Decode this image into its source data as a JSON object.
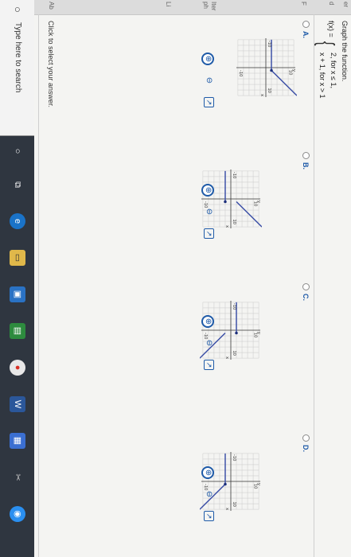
{
  "question": {
    "prompt": "Graph the function.",
    "lhs": "f(x) =",
    "case1": "2,  for x ≤ 1,",
    "case2": "x + 1,  for x > 1"
  },
  "left_strip": [
    "er",
    "d",
    "F",
    "Iter",
    "ph",
    "Li",
    "Ab"
  ],
  "options": [
    {
      "label": "A.",
      "tick_top": "10",
      "tick_left": "-10",
      "tick_right": "10",
      "tick_bottom": "-10",
      "axis_y": "y",
      "axis_x": "x"
    },
    {
      "label": "B.",
      "tick_top": "10",
      "tick_left": "-10",
      "tick_right": "10",
      "tick_bottom": "-10",
      "axis_y": "y",
      "axis_x": "x"
    },
    {
      "label": "C.",
      "tick_top": "10",
      "tick_left": "-10",
      "tick_right": "10",
      "tick_bottom": "-10",
      "axis_y": "y",
      "axis_x": "x"
    },
    {
      "label": "D.",
      "tick_top": "10",
      "tick_left": "-10",
      "tick_right": "10",
      "tick_bottom": "-10",
      "axis_y": "y",
      "axis_x": "x"
    }
  ],
  "tools": {
    "zoom_in": "⊕",
    "zoom_out": "⊖",
    "popout": "↗"
  },
  "footer_note": "Click to select your answer.",
  "taskbar": {
    "search_placeholder": "Type here to search",
    "icons": [
      "search-icon",
      "task-view-icon",
      "edge-icon",
      "file-explorer-icon",
      "store-icon",
      "chrome-icon",
      "word-icon",
      "scissors-icon",
      "blue-app-icon"
    ]
  },
  "colors": {
    "accent": "#1e5aa8",
    "line": "#3a4ea6",
    "grid": "#c9c9c9"
  }
}
